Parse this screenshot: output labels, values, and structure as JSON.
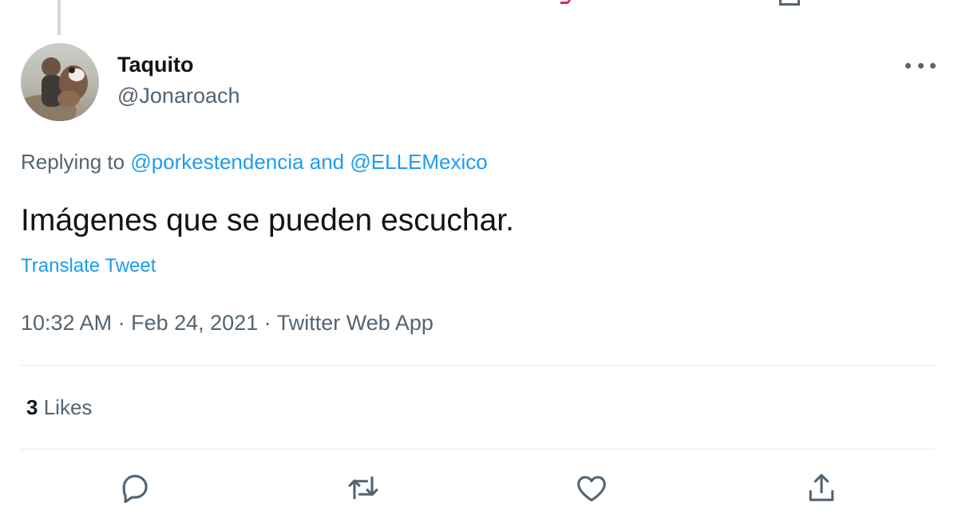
{
  "tweet": {
    "display_name": "Taquito",
    "handle": "@Jonaroach",
    "replying_prefix": "Replying to",
    "replying_user_1": "@porkestendencia",
    "replying_joiner": "and",
    "replying_user_2": "@ELLEMexico",
    "text": "Imágenes que se pueden escuchar.",
    "translate_label": "Translate Tweet",
    "time": "10:32 AM",
    "date": "Feb 24, 2021",
    "source": "Twitter Web App",
    "separator": "·",
    "likes_count": "3",
    "likes_label": "Likes"
  },
  "actions": [
    {
      "name": "reply",
      "icon": "reply-icon"
    },
    {
      "name": "retweet",
      "icon": "retweet-icon"
    },
    {
      "name": "like",
      "icon": "heart-icon"
    },
    {
      "name": "share",
      "icon": "share-icon"
    }
  ],
  "colors": {
    "link": "#1d9bf0",
    "secondary_text": "#536471",
    "primary_text": "#0f1419",
    "divider": "#e6ecf0"
  }
}
